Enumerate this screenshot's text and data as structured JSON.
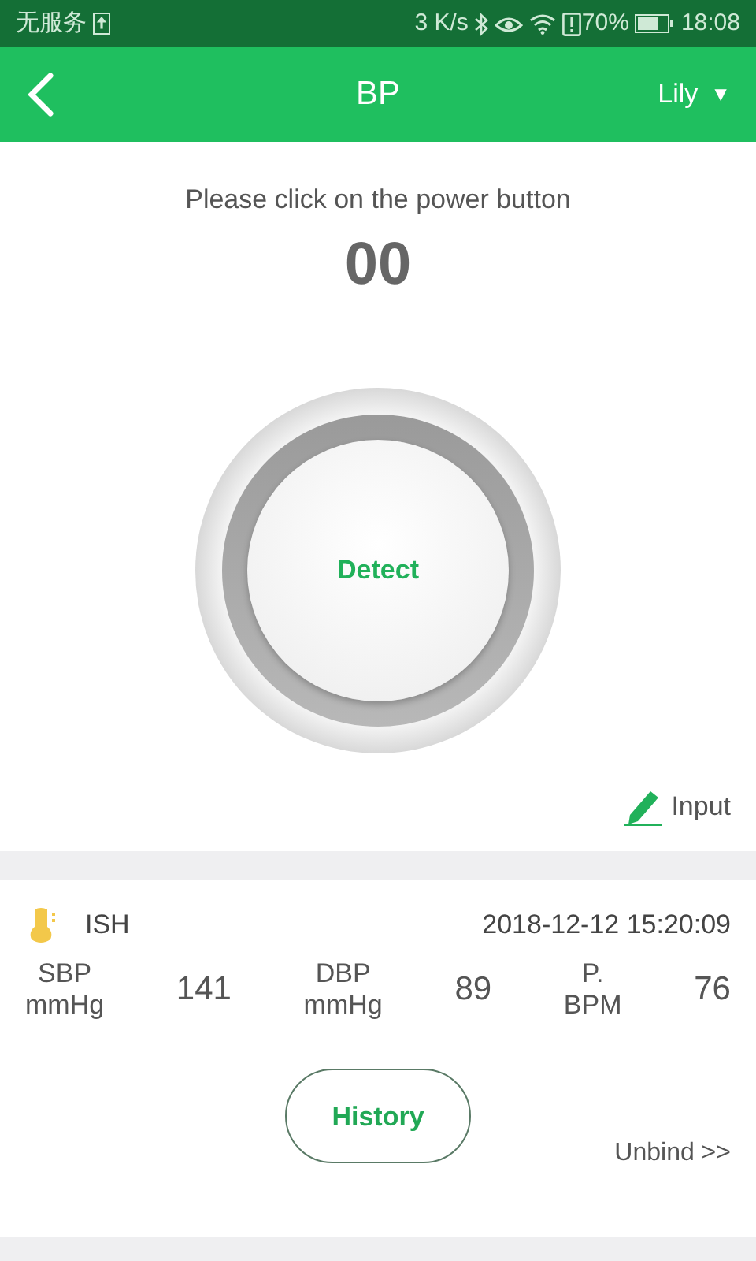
{
  "status_bar": {
    "carrier": "无服务",
    "speed": "3 K/s",
    "battery_percent": "70%",
    "time": "18:08"
  },
  "header": {
    "title": "BP",
    "user": "Lily",
    "user_caret": "▼"
  },
  "measure": {
    "prompt": "Please click on the power button",
    "reading": "00",
    "detect_label": "Detect",
    "input_label": "Input"
  },
  "last_result": {
    "classification": "ISH",
    "datetime": "2018-12-12 15:20:09",
    "metrics": [
      {
        "label": "SBP\nmmHg",
        "value": "141"
      },
      {
        "label": "DBP\nmmHg",
        "value": "89"
      },
      {
        "label": "P.\nBPM",
        "value": "76"
      }
    ]
  },
  "actions": {
    "history": "History",
    "unbind": "Unbind >>"
  }
}
